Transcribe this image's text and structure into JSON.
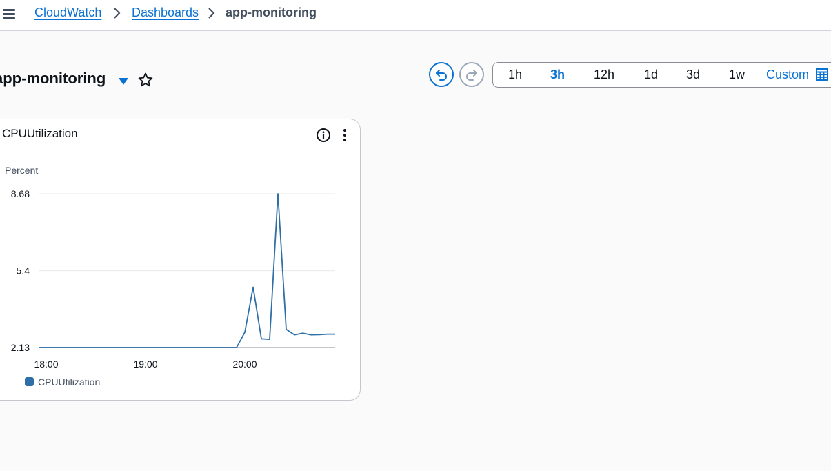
{
  "breadcrumb": {
    "items": [
      "CloudWatch",
      "Dashboards"
    ],
    "current": "app-monitoring"
  },
  "dashboard": {
    "title": "app-monitoring"
  },
  "time_range": {
    "options": [
      "1h",
      "3h",
      "12h",
      "1d",
      "3d",
      "1w"
    ],
    "selected": "3h",
    "custom_label": "Custom"
  },
  "widget": {
    "title": "CPUUtilization",
    "y_unit": "Percent",
    "legend": "CPUUtilization"
  },
  "colors": {
    "accent": "#0972d3",
    "series": "#2e6fa7",
    "disabled": "#9ba7b6"
  },
  "chart_data": {
    "type": "line",
    "title": "CPUUtilization",
    "ylabel": "Percent",
    "y_ticks": [
      "8.68",
      "5.4",
      "2.13"
    ],
    "x_ticks": [
      "18:00",
      "19:00",
      "20:00"
    ],
    "ylim": [
      2.13,
      8.68
    ],
    "grid": true,
    "legend_position": "bottom-left",
    "series": [
      {
        "name": "CPUUtilization",
        "x": [
          "17:55",
          "18:00",
          "18:05",
          "18:10",
          "18:15",
          "18:20",
          "18:25",
          "18:30",
          "18:35",
          "18:40",
          "18:45",
          "18:50",
          "18:55",
          "19:00",
          "19:05",
          "19:10",
          "19:15",
          "19:20",
          "19:25",
          "19:30",
          "19:35",
          "19:40",
          "19:45",
          "19:50",
          "19:55",
          "20:00",
          "20:05",
          "20:10",
          "20:15",
          "20:20",
          "20:25",
          "20:30",
          "20:35",
          "20:40",
          "20:45",
          "20:50",
          "20:55"
        ],
        "values": [
          2.13,
          2.13,
          2.13,
          2.13,
          2.13,
          2.13,
          2.13,
          2.13,
          2.13,
          2.13,
          2.13,
          2.13,
          2.13,
          2.13,
          2.13,
          2.13,
          2.13,
          2.13,
          2.13,
          2.13,
          2.13,
          2.13,
          2.13,
          2.13,
          2.13,
          2.78,
          4.7,
          2.5,
          2.48,
          8.68,
          2.9,
          2.67,
          2.74,
          2.67,
          2.68,
          2.7,
          2.7
        ]
      }
    ]
  }
}
